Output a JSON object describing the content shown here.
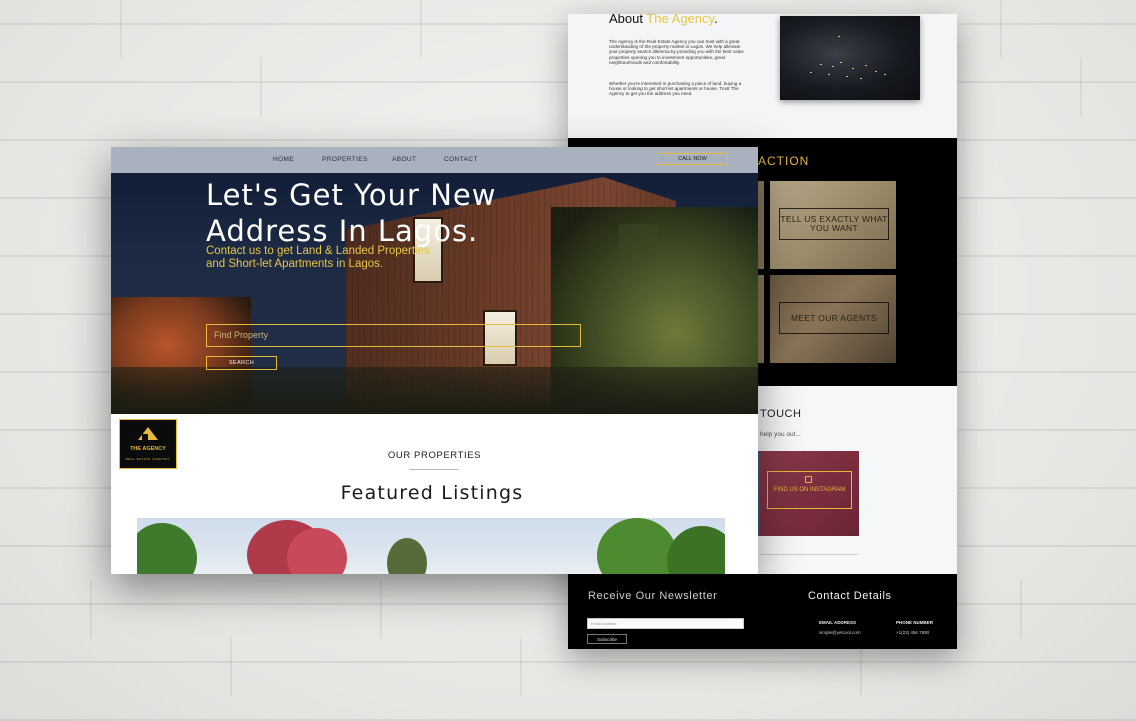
{
  "back_page": {
    "about": {
      "title_prefix": "About ",
      "title_accent": "The Agency",
      "title_suffix": ".",
      "para1": "The Agency is the Real Estate Agency you can trust with a great understanding of the property market in Lagos. We help alleviate your property search dilemma by providing you with the best value properties opening you to investment opportunities, great neighbourhoods and comfortability.",
      "para2": "Whether you're interested in purchasing a piece of land, buying a house or looking to get short-let apartments or house. Trust The Agency to get you the address you need."
    },
    "cta": {
      "title": "ACTION",
      "tile1": "TELL US EXACTLY WHAT YOU WANT",
      "tile2": "MEET OUR AGENTS"
    },
    "touch": {
      "title": "TOUCH",
      "subtitle": "help you out...",
      "instagram": "FIND US ON INSTAGRAM"
    },
    "footer": {
      "newsletter_title": "Receive Our Newsletter",
      "email_placeholder": "Email address",
      "subscribe": "Subscribe",
      "contact_title": "Contact Details",
      "email_label": "EMAIL ADDRESS",
      "email_value": "simple@yetcool.com",
      "phone_label": "PHONE NUMBER",
      "phone_value": "+1(23) 456 7890"
    }
  },
  "front_page": {
    "nav": {
      "items": [
        "HOME",
        "PROPERTIES",
        "ABOUT",
        "CONTACT"
      ],
      "call_now": "CALL NOW"
    },
    "hero": {
      "headline": "Let's Get Your New Address In Lagos.",
      "subtext": "Contact us to get Land & Landed Properties and Short-let Apartments in Lagos.",
      "search_placeholder": "Find Property",
      "search_button": "SEARCH"
    },
    "logo": {
      "name": "THE AGENCY",
      "tagline": "REAL ESTATE COMPANY"
    },
    "section": {
      "label": "OUR PROPERTIES",
      "title": "Featured Listings"
    }
  },
  "colors": {
    "accent": "#e6b93c",
    "dark": "#000000",
    "light": "#f6f7f8"
  }
}
